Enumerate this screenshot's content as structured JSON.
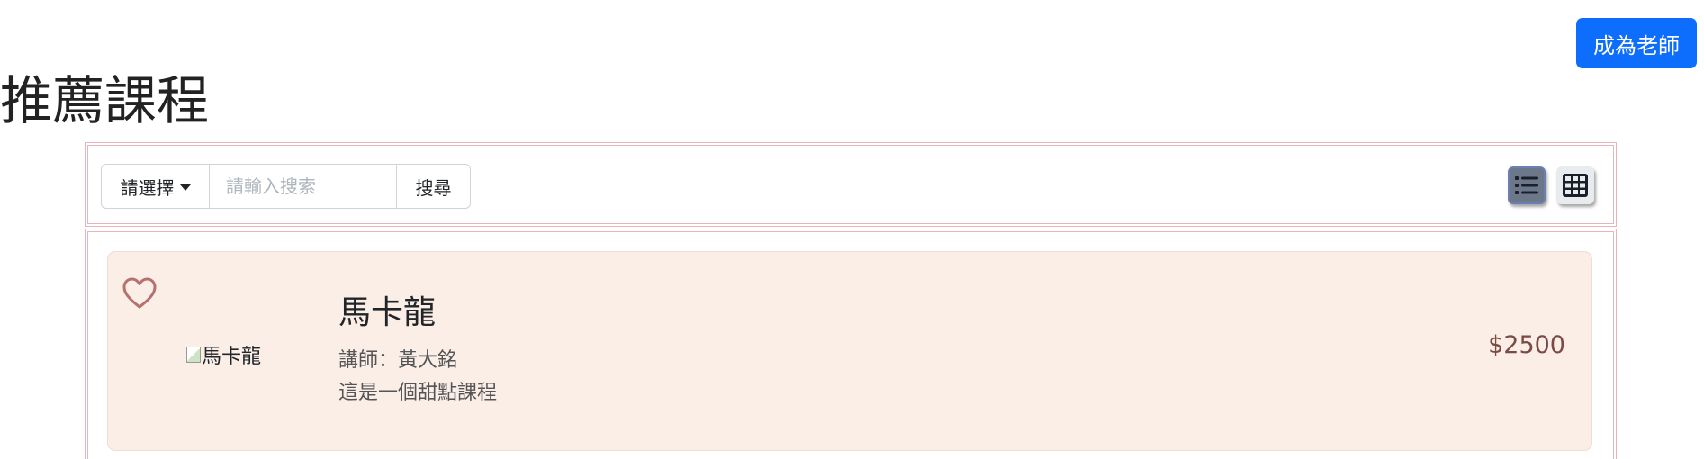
{
  "header": {
    "become_teacher_label": "成為老師",
    "page_title": "推薦課程"
  },
  "search": {
    "dropdown_label": "請選擇",
    "placeholder": "請輸入搜索",
    "value": "",
    "search_button_label": "搜尋"
  },
  "view_toggle": {
    "list_icon": "list-icon",
    "grid_icon": "grid-icon",
    "active": "list"
  },
  "courses": [
    {
      "favorite_icon": "heart-outline-icon",
      "image_alt": "馬卡龍",
      "title": "馬卡龍",
      "teacher": "講師：黃大銘",
      "description": "這是一個甜點課程",
      "price": "$2500"
    }
  ],
  "colors": {
    "primary": "#0d6efd",
    "card_bg": "#faeee7",
    "panel_border": "#e8b4bc",
    "heart": "#b5706f",
    "price": "#7a4b44"
  }
}
